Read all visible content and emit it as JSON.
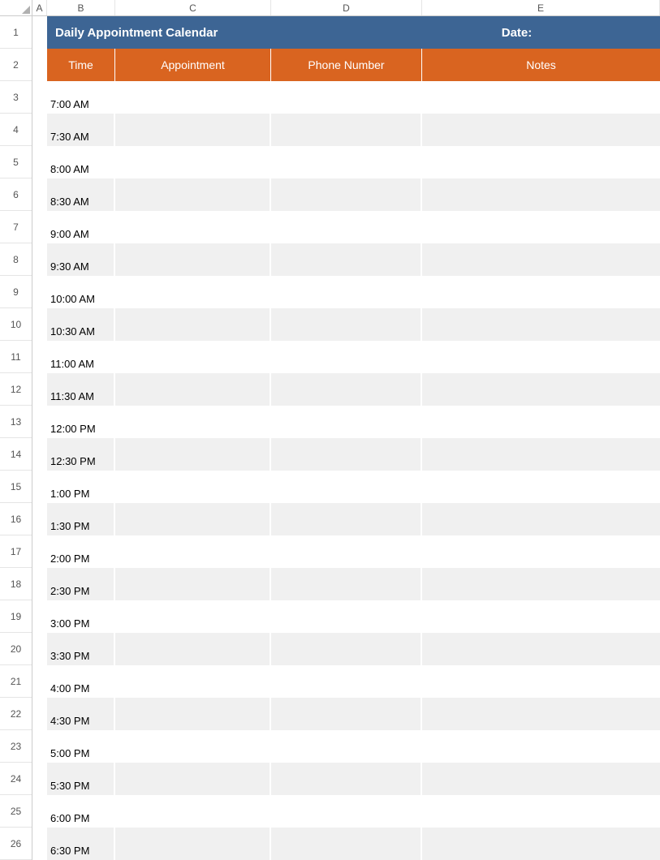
{
  "columns": [
    "A",
    "B",
    "C",
    "D",
    "E"
  ],
  "rowNumbers": [
    1,
    2,
    3,
    4,
    5,
    6,
    7,
    8,
    9,
    10,
    11,
    12,
    13,
    14,
    15,
    16,
    17,
    18,
    19,
    20,
    21,
    22,
    23,
    24,
    25,
    26
  ],
  "title": "Daily Appointment Calendar",
  "dateLabel": "Date:",
  "headers": {
    "time": "Time",
    "appointment": "Appointment",
    "phone": "Phone Number",
    "notes": "Notes"
  },
  "slots": [
    {
      "time": "7:00 AM",
      "appointment": "",
      "phone": "",
      "notes": "",
      "shaded": false
    },
    {
      "time": "7:30 AM",
      "appointment": "",
      "phone": "",
      "notes": "",
      "shaded": true
    },
    {
      "time": "8:00 AM",
      "appointment": "",
      "phone": "",
      "notes": "",
      "shaded": false
    },
    {
      "time": "8:30 AM",
      "appointment": "",
      "phone": "",
      "notes": "",
      "shaded": true
    },
    {
      "time": "9:00 AM",
      "appointment": "",
      "phone": "",
      "notes": "",
      "shaded": false
    },
    {
      "time": "9:30 AM",
      "appointment": "",
      "phone": "",
      "notes": "",
      "shaded": true
    },
    {
      "time": "10:00 AM",
      "appointment": "",
      "phone": "",
      "notes": "",
      "shaded": false
    },
    {
      "time": "10:30 AM",
      "appointment": "",
      "phone": "",
      "notes": "",
      "shaded": true
    },
    {
      "time": "11:00 AM",
      "appointment": "",
      "phone": "",
      "notes": "",
      "shaded": false
    },
    {
      "time": "11:30 AM",
      "appointment": "",
      "phone": "",
      "notes": "",
      "shaded": true
    },
    {
      "time": "12:00 PM",
      "appointment": "",
      "phone": "",
      "notes": "",
      "shaded": false
    },
    {
      "time": "12:30 PM",
      "appointment": "",
      "phone": "",
      "notes": "",
      "shaded": true
    },
    {
      "time": "1:00 PM",
      "appointment": "",
      "phone": "",
      "notes": "",
      "shaded": false
    },
    {
      "time": "1:30 PM",
      "appointment": "",
      "phone": "",
      "notes": "",
      "shaded": true
    },
    {
      "time": "2:00 PM",
      "appointment": "",
      "phone": "",
      "notes": "",
      "shaded": false
    },
    {
      "time": "2:30 PM",
      "appointment": "",
      "phone": "",
      "notes": "",
      "shaded": true
    },
    {
      "time": "3:00 PM",
      "appointment": "",
      "phone": "",
      "notes": "",
      "shaded": false
    },
    {
      "time": "3:30 PM",
      "appointment": "",
      "phone": "",
      "notes": "",
      "shaded": true
    },
    {
      "time": "4:00 PM",
      "appointment": "",
      "phone": "",
      "notes": "",
      "shaded": false
    },
    {
      "time": "4:30 PM",
      "appointment": "",
      "phone": "",
      "notes": "",
      "shaded": true
    },
    {
      "time": "5:00 PM",
      "appointment": "",
      "phone": "",
      "notes": "",
      "shaded": false
    },
    {
      "time": "5:30 PM",
      "appointment": "",
      "phone": "",
      "notes": "",
      "shaded": true
    },
    {
      "time": "6:00 PM",
      "appointment": "",
      "phone": "",
      "notes": "",
      "shaded": false
    },
    {
      "time": "6:30 PM",
      "appointment": "",
      "phone": "",
      "notes": "",
      "shaded": true
    }
  ]
}
